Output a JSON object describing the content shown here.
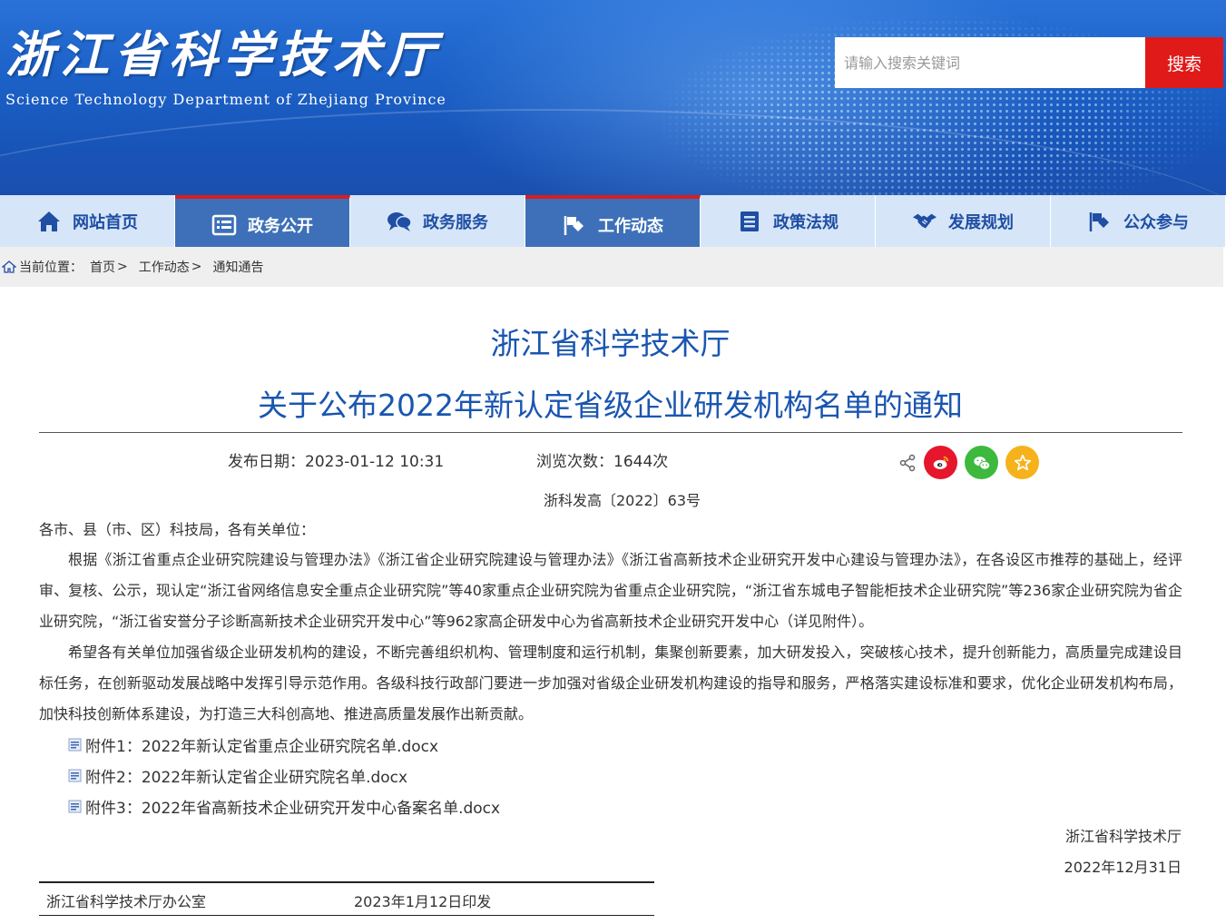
{
  "header": {
    "title": "浙江省科学技术厅",
    "subtitle": "Science Technology Department of Zhejiang Province",
    "search_placeholder": "请输入搜索关键词",
    "search_button": "搜索"
  },
  "nav": {
    "items": [
      {
        "label": "网站首页",
        "icon": "home-icon"
      },
      {
        "label": "政务公开",
        "icon": "list-icon"
      },
      {
        "label": "政务服务",
        "icon": "chat-bubbles-icon"
      },
      {
        "label": "工作动态",
        "icon": "diamond-flag-icon"
      },
      {
        "label": "政策法规",
        "icon": "document-icon"
      },
      {
        "label": "发展规划",
        "icon": "handshake-icon"
      },
      {
        "label": "公众参与",
        "icon": "diamond-flag-icon"
      }
    ]
  },
  "breadcrumb": {
    "label": "当前位置：",
    "items": [
      "首页",
      "工作动态",
      "通知通告"
    ],
    "separator": ">"
  },
  "article": {
    "issuer": "浙江省科学技术厅",
    "title": "关于公布2022年新认定省级企业研发机构名单的通知",
    "publish_date": "发布日期：2023-01-12 10:31",
    "views": "浏览次数：1644次",
    "doc_number": "浙科发高〔2022〕63号",
    "salutation": "各市、县（市、区）科技局，各有关单位：",
    "paragraph1": "根据《浙江省重点企业研究院建设与管理办法》《浙江省企业研究院建设与管理办法》《浙江省高新技术企业研究开发中心建设与管理办法》，在各设区市推荐的基础上，经评审、复核、公示，现认定“浙江省网络信息安全重点企业研究院”等40家重点企业研究院为省重点企业研究院，“浙江省东城电子智能柜技术企业研究院”等236家企业研究院为省企业研究院，“浙江省安誉分子诊断高新技术企业研究开发中心”等962家高企研发中心为省高新技术企业研究开发中心（详见附件）。",
    "paragraph2": "希望各有关单位加强省级企业研发机构的建设，不断完善组织机构、管理制度和运行机制，集聚创新要素，加大研发投入，突破核心技术，提升创新能力，高质量完成建设目标任务，在创新驱动发展战略中发挥引导示范作用。各级科技行政部门要进一步加强对省级企业研发机构建设的指导和服务，严格落实建设标准和要求，优化企业研发机构布局，加快科技创新体系建设，为打造三大科创高地、推进高质量发展作出新贡献。",
    "attachments": [
      "附件1：2022年新认定省重点企业研究院名单.docx",
      "附件2：2022年新认定省企业研究院名单.docx",
      "附件3：2022年省高新技术企业研究开发中心备案名单.docx"
    ],
    "signature_org": "浙江省科学技术厅",
    "signature_date": "2022年12月31日",
    "footer_org": "浙江省科学技术厅办公室",
    "footer_date": "2023年1月12日印发"
  },
  "share": {
    "icons": [
      "share-icon",
      "weibo-icon",
      "wechat-icon",
      "favorite-star-icon"
    ]
  },
  "colors": {
    "banner": "#1d63c9",
    "nav_light": "#d6e6f8",
    "nav_dark": "#3d70b8",
    "nav_active_border": "#d81e1e",
    "search_button": "#e01919",
    "title_blue": "#1a56b0",
    "weibo": "#e6162d",
    "wechat": "#3db93d",
    "favorite": "#f6b21b"
  }
}
